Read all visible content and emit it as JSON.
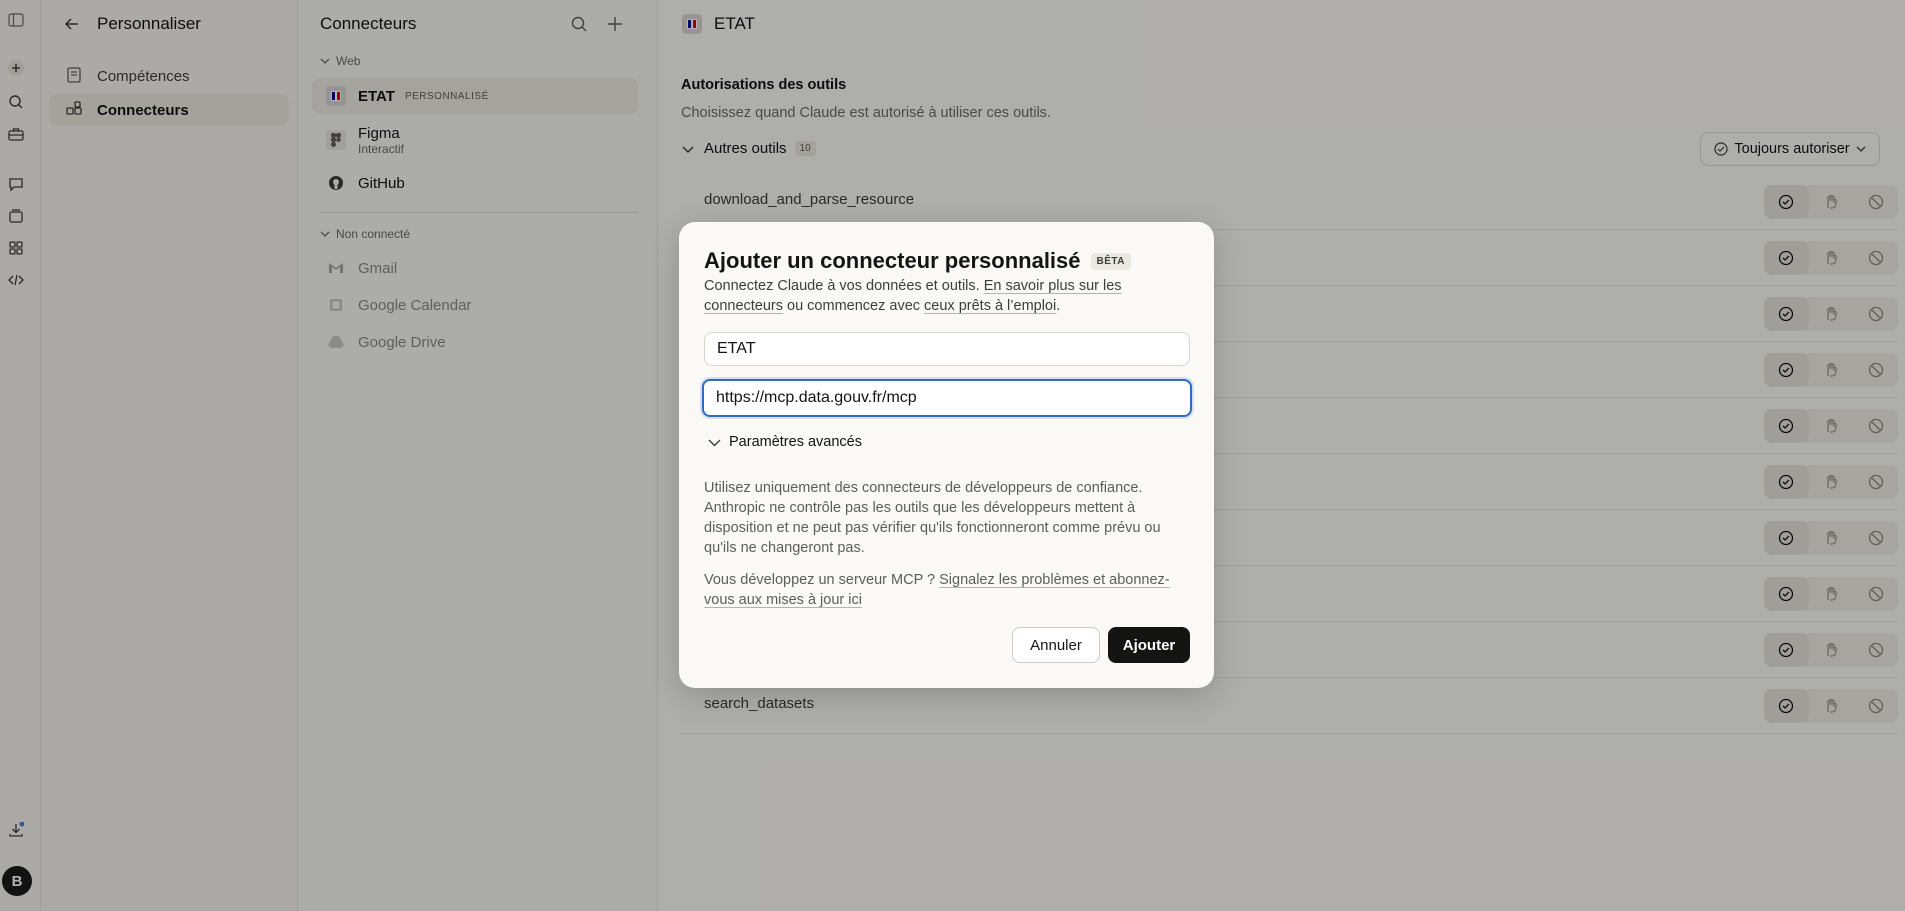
{
  "sidebar_nav": {
    "title": "Personnaliser",
    "items": [
      {
        "label": "Compétences",
        "icon": "book-icon"
      },
      {
        "label": "Connecteurs",
        "icon": "connector-icon",
        "active": true
      }
    ]
  },
  "connectors_panel": {
    "title": "Connecteurs",
    "groups": [
      {
        "label": "Web",
        "items": [
          {
            "name": "ETAT",
            "badge": "PERSONNALISÉ"
          },
          {
            "name": "Figma",
            "subtitle": "Interactif"
          },
          {
            "name": "GitHub"
          }
        ]
      },
      {
        "label": "Non connecté",
        "items": [
          {
            "name": "Gmail"
          },
          {
            "name": "Google Calendar"
          },
          {
            "name": "Google Drive"
          }
        ]
      }
    ]
  },
  "main": {
    "title": "ETAT",
    "permissions_heading": "Autorisations des outils",
    "permissions_desc": "Choisissez quand Claude est autorisé à utiliser ces outils.",
    "other_tools_label": "Autres outils",
    "other_tools_count": "10",
    "permission_select": "Toujours autoriser",
    "tools": [
      "download_and_parse_resource",
      "search_datasets"
    ]
  },
  "modal": {
    "title": "Ajouter un connecteur personnalisé",
    "beta": "BÊTA",
    "desc_1": "Connectez Claude à vos données et outils. ",
    "desc_link_1": "En savoir plus sur les connecteurs",
    "desc_2": " ou commencez avec ",
    "desc_link_2": "ceux prêts à l’emploi",
    "desc_3": ".",
    "name_value": "ETAT",
    "url_value": "https://mcp.data.gouv.fr/mcp",
    "advanced_label": "Paramètres avancés",
    "warning": "Utilisez uniquement des connecteurs de développeurs de confiance. Anthropic ne contrôle pas les outils que les développeurs mettent à disposition et ne peut pas vérifier qu'ils fonctionneront comme prévu ou qu'ils ne changeront pas.",
    "dev_text": "Vous développez un serveur MCP ? ",
    "dev_link": "Signalez les problèmes et abonnez-vous aux mises à jour ici",
    "cancel": "Annuler",
    "add": "Ajouter"
  },
  "user": {
    "avatar_initial": "B"
  }
}
